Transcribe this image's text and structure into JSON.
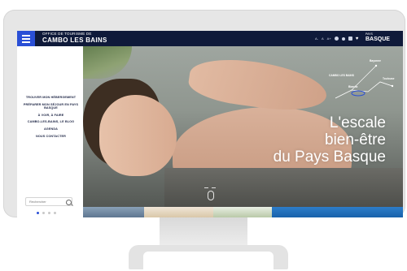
{
  "header": {
    "brand_line1": "OFFICE DE TOURISME DE",
    "brand_line2": "CAMBO LES BAINS",
    "logo_small": "PAYS",
    "logo_big": "BASQUE",
    "tools": [
      "A-",
      "A",
      "A+"
    ]
  },
  "sidebar": {
    "nav": [
      {
        "label": "TROUVER MON HÉBERGEMENT"
      },
      {
        "label": "PRÉPARER MON SÉJOUR EN PAYS BASQUE"
      },
      {
        "label": "À VOIR, À FAIRE"
      },
      {
        "label": "CAMBO-LES-BAINS, LE BLOG"
      },
      {
        "label": "AGENDA"
      },
      {
        "label": "NOUS CONTACTER"
      }
    ],
    "search_placeholder": "Rechercher"
  },
  "hero": {
    "title_lines": [
      "L'escale",
      "bien-être",
      "du Pays Basque"
    ],
    "map_labels": [
      "CAMBO LES BAINS",
      "Bayonne",
      "Toulouse",
      "Biarritz"
    ]
  },
  "colors": {
    "topbar": "#0f1a3a",
    "accent": "#2a4fd6",
    "nav_text": "#1d2545"
  }
}
